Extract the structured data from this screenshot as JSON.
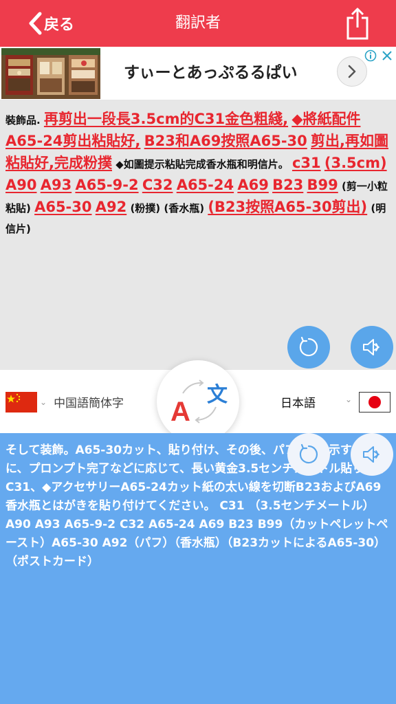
{
  "header": {
    "back_label": "戻る",
    "title": "翻訳者"
  },
  "ad": {
    "text": "すぃーとあっぷるるぱい"
  },
  "source": {
    "segments": [
      {
        "text": "裝飾品. ",
        "red": false
      },
      {
        "text": "再剪出一段長3.5cm的C31金色粗綫,",
        "red": true
      },
      {
        "text": " ",
        "red": false
      },
      {
        "text": "◆將紙配件A65-24剪出粘貼好,",
        "red": true
      },
      {
        "text": " ",
        "red": false
      },
      {
        "text": "B23和A69按照A65-30",
        "red": true
      },
      {
        "text": " ",
        "red": false
      },
      {
        "text": "剪出,再如圖粘貼好,完成粉撲",
        "red": true
      },
      {
        "text": " ◆如圖提示粘貼完成香水瓶和明信片。 ",
        "red": false
      },
      {
        "text": "c31",
        "red": true
      },
      {
        "text": " ",
        "red": false
      },
      {
        "text": "(3.5cm)",
        "red": true
      },
      {
        "text": " ",
        "red": false
      },
      {
        "text": "A90",
        "red": true
      },
      {
        "text": " ",
        "red": false
      },
      {
        "text": "A93",
        "red": true
      },
      {
        "text": " ",
        "red": false
      },
      {
        "text": "A65-9-2",
        "red": true
      },
      {
        "text": " ",
        "red": false
      },
      {
        "text": "C32",
        "red": true
      },
      {
        "text": " ",
        "red": false
      },
      {
        "text": "A65-24",
        "red": true
      },
      {
        "text": " ",
        "red": false
      },
      {
        "text": "A69",
        "red": true
      },
      {
        "text": " ",
        "red": false
      },
      {
        "text": "B23",
        "red": true
      },
      {
        "text": " ",
        "red": false
      },
      {
        "text": "B99",
        "red": true
      },
      {
        "text": " (剪一小粒粘貼) ",
        "red": false
      },
      {
        "text": "A65-30",
        "red": true
      },
      {
        "text": " ",
        "red": false
      },
      {
        "text": "A92",
        "red": true
      },
      {
        "text": " (粉撲) (香水瓶) ",
        "red": false
      },
      {
        "text": "(B23按照A65-30剪出)",
        "red": true
      },
      {
        "text": " (明信片)",
        "red": false
      }
    ]
  },
  "languages": {
    "source_label": "中国語簡体字",
    "target_label": "日本語"
  },
  "target": {
    "text": "そして装飾。A65-30カット、貼り付け、その後、パフ◆図の示すように、プロンプト完了などに応じて、長い黄金3.5センチメートル貼り付けC31、◆アクセサリーA65-24カット紙の太い線を切断B23およびA69 香水瓶とはがきを貼り付けてください。 C31 （3.5センチメートル）A90 A93 A65-9-2 C32 A65-24 A69 B23 B99（カットペレットペースト）A65-30 A92（パフ）（香水瓶）（B23カットによるA65-30）（ポストカード）"
  },
  "colors": {
    "header_red": "#ee3c4c",
    "source_red_text": "#e8262f",
    "target_blue": "#65a9ef",
    "button_blue": "#5aa6ea"
  },
  "icons": [
    "chevron-left-icon",
    "share-icon",
    "info-icon",
    "close-icon",
    "chevron-right-icon",
    "refresh-icon",
    "speaker-icon",
    "translate-swap-icon"
  ]
}
